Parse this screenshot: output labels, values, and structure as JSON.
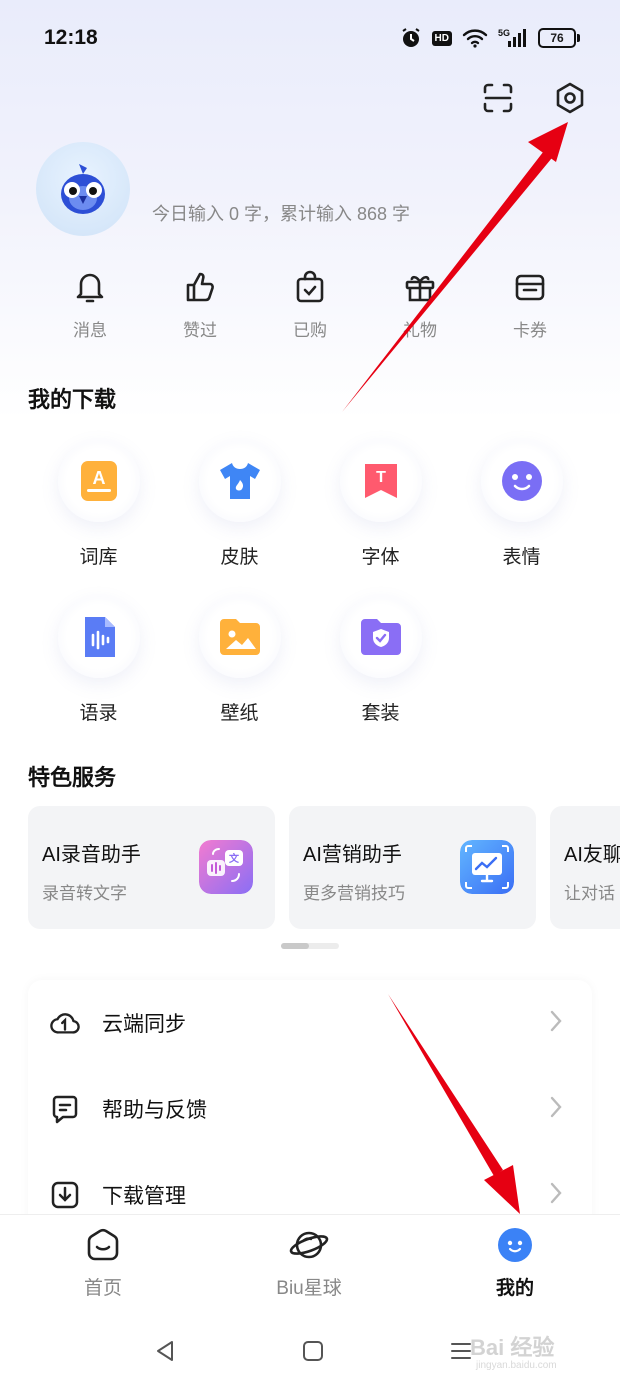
{
  "status_bar": {
    "time": "12:18",
    "hd": "HD",
    "network": "5G",
    "battery": "76"
  },
  "profile": {
    "input_stats": "今日输入 0 字，累计输入 868 字"
  },
  "quick_actions": [
    {
      "label": "消息",
      "icon": "bell-icon"
    },
    {
      "label": "赞过",
      "icon": "thumbs-up-icon"
    },
    {
      "label": "已购",
      "icon": "shopping-bag-icon"
    },
    {
      "label": "礼物",
      "icon": "gift-icon"
    },
    {
      "label": "卡券",
      "icon": "wallet-icon"
    }
  ],
  "downloads": {
    "title": "我的下载",
    "items": [
      {
        "label": "词库",
        "icon": "dictionary-icon",
        "color": "#ffb13b"
      },
      {
        "label": "皮肤",
        "icon": "tshirt-icon",
        "color": "#3f86f5"
      },
      {
        "label": "字体",
        "icon": "font-icon",
        "color": "#ff5a6e"
      },
      {
        "label": "表情",
        "icon": "emoji-icon",
        "color": "#7a6ef5"
      },
      {
        "label": "语录",
        "icon": "voice-note-icon",
        "color": "#5a7cf5"
      },
      {
        "label": "壁纸",
        "icon": "wallpaper-icon",
        "color": "#ffb13b"
      },
      {
        "label": "套装",
        "icon": "folder-badge-icon",
        "color": "#8a6ef5"
      }
    ]
  },
  "services": {
    "title": "特色服务",
    "items": [
      {
        "title": "AI录音助手",
        "subtitle": "录音转文字",
        "icon": "voice-translate-icon"
      },
      {
        "title": "AI营销助手",
        "subtitle": "更多营销技巧",
        "icon": "marketing-chart-icon"
      },
      {
        "title": "AI友聊",
        "subtitle": "让对话",
        "icon": "chat-icon"
      }
    ]
  },
  "settings": [
    {
      "label": "云端同步",
      "icon": "cloud-sync-icon"
    },
    {
      "label": "帮助与反馈",
      "icon": "feedback-icon"
    },
    {
      "label": "下载管理",
      "icon": "download-icon"
    }
  ],
  "tabs": [
    {
      "label": "首页",
      "icon": "home-icon"
    },
    {
      "label": "Biu星球",
      "icon": "planet-icon"
    },
    {
      "label": "我的",
      "icon": "mine-icon"
    }
  ],
  "colors": {
    "accent": "#3b82f6",
    "annotation": "#e60012"
  },
  "watermark": {
    "text": "Bai 经验",
    "sub": "jingyan.baidu.com"
  }
}
